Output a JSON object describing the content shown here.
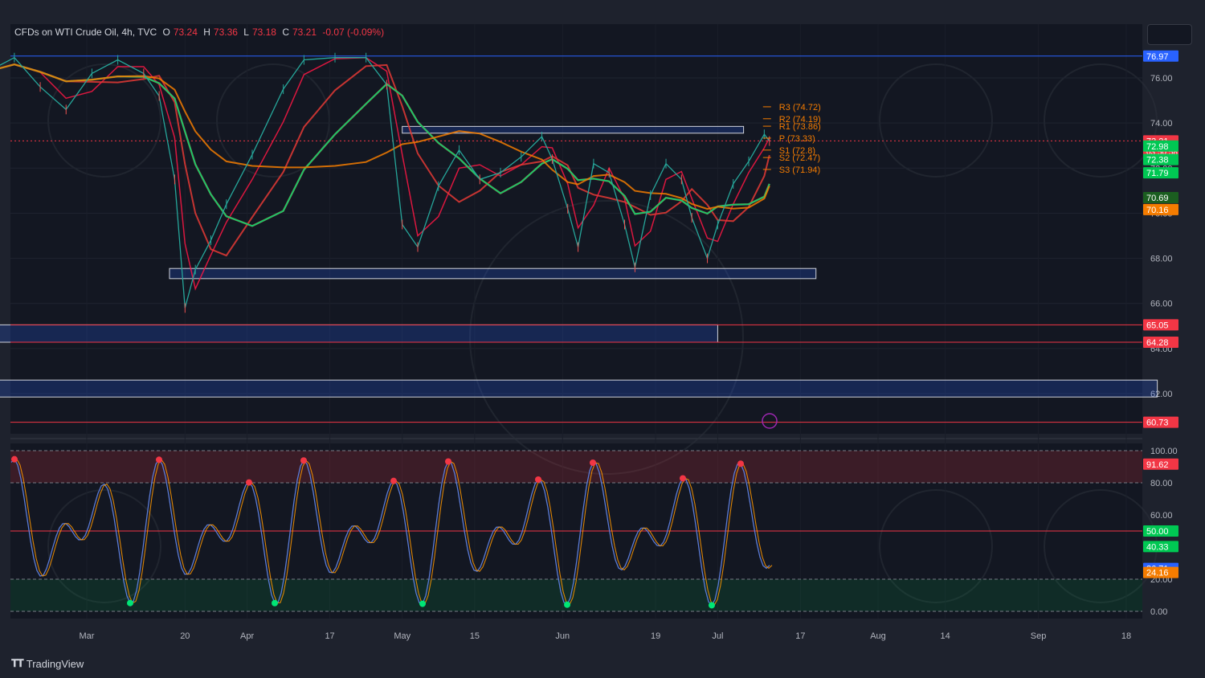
{
  "header": {
    "symbol": "CFDs on WTI Crude Oil, 4h, TVC",
    "open_label": "O",
    "open": "73.24",
    "high_label": "H",
    "high": "73.36",
    "low_label": "L",
    "low": "73.18",
    "close_label": "C",
    "close": "73.21",
    "change": "-0.07 (-0.09%)"
  },
  "brand": {
    "name": "TradingView"
  },
  "chart_data": [
    {
      "type": "line",
      "name": "price",
      "x_ticks": [
        "Mar",
        "20",
        "Apr",
        "17",
        "May",
        "15",
        "Jun",
        "19",
        "Jul",
        "17",
        "Aug",
        "14",
        "Sep",
        "18"
      ],
      "y_ticks": [
        "76.00",
        "74.00",
        "72.00",
        "70.00",
        "68.00",
        "66.00",
        "64.00",
        "62.00"
      ],
      "ylim": [
        59.2,
        77.2
      ],
      "horizontal_levels": [
        {
          "value": 76.97,
          "color": "#2962ff"
        },
        {
          "value": 73.21,
          "color": "#f23645",
          "style": "dotted"
        },
        {
          "value": 65.05,
          "color": "#f23645"
        },
        {
          "value": 64.28,
          "color": "#f23645"
        },
        {
          "value": 60.73,
          "color": "#f23645"
        }
      ],
      "zones": [
        {
          "from": 73.55,
          "to": 73.85,
          "x_start": "2024-05-01",
          "x_end": "2024-07-06"
        },
        {
          "from": 67.1,
          "to": 67.55,
          "x_start": "2024-03-17",
          "x_end": "2024-07-20"
        },
        {
          "from": 64.28,
          "to": 65.05,
          "x_start": "2024-02-11",
          "x_end": "2024-07-01"
        },
        {
          "from": 61.85,
          "to": 62.6,
          "x_start": "2024-02-11",
          "x_end": "2024-09-24"
        }
      ],
      "pivots": [
        {
          "label": "R3 (74.72)",
          "value": 74.72
        },
        {
          "label": "R2 (74.19)",
          "value": 74.19
        },
        {
          "label": "R1 (73.86)",
          "value": 73.86
        },
        {
          "label": "P (73.33)",
          "value": 73.33
        },
        {
          "label": "S1 (72.8)",
          "value": 72.8
        },
        {
          "label": "S2 (72.47)",
          "value": 72.47
        },
        {
          "label": "S3 (71.94)",
          "value": 71.94
        }
      ],
      "price_labels": [
        {
          "text": "76.97",
          "value": 76.97,
          "color": "#2962ff"
        },
        {
          "text": "73.21",
          "value": 73.21,
          "color": "#f23645",
          "sub": "03:50:58"
        },
        {
          "text": "72.98",
          "value": 72.98,
          "color": "#00c853"
        },
        {
          "text": "72.38",
          "value": 72.38,
          "color": "#00c853"
        },
        {
          "text": "71.79",
          "value": 71.79,
          "color": "#00c853"
        },
        {
          "text": "70.69",
          "value": 70.69,
          "color": "#1b5e20"
        },
        {
          "text": "70.16",
          "value": 70.16,
          "color": "#f57c00"
        },
        {
          "text": "65.05",
          "value": 65.05,
          "color": "#f23645"
        },
        {
          "text": "64.28",
          "value": 64.28,
          "color": "#f23645"
        },
        {
          "text": "60.73",
          "value": 60.73,
          "color": "#f23645"
        }
      ],
      "series": [
        {
          "name": "",
          "color": "#26a69a",
          "points": [
            [
              "2024-02-11",
              76.3
            ],
            [
              "2024-02-16",
              76.9
            ],
            [
              "2024-02-21",
              75.6
            ],
            [
              "2024-02-26",
              74.6
            ],
            [
              "2024-03-02",
              76.2
            ],
            [
              "2024-03-07",
              76.8
            ],
            [
              "2024-03-12",
              76.2
            ],
            [
              "2024-03-15",
              75.2
            ],
            [
              "2024-03-18",
              71.5
            ],
            [
              "2024-03-20",
              65.8
            ],
            [
              "2024-03-22",
              67.5
            ],
            [
              "2024-03-25",
              68.8
            ],
            [
              "2024-03-28",
              70.4
            ],
            [
              "2024-04-02",
              72.6
            ],
            [
              "2024-04-08",
              75.5
            ],
            [
              "2024-04-12",
              76.8
            ],
            [
              "2024-04-18",
              76.9
            ],
            [
              "2024-04-24",
              76.9
            ],
            [
              "2024-04-28",
              75.7
            ],
            [
              "2024-05-01",
              69.5
            ],
            [
              "2024-05-04",
              68.5
            ],
            [
              "2024-05-08",
              71.2
            ],
            [
              "2024-05-12",
              72.8
            ],
            [
              "2024-05-16",
              71.5
            ],
            [
              "2024-05-20",
              71.8
            ],
            [
              "2024-05-24",
              72.5
            ],
            [
              "2024-05-28",
              73.4
            ],
            [
              "2024-05-30",
              72.4
            ],
            [
              "2024-06-02",
              70.2
            ],
            [
              "2024-06-04",
              68.5
            ],
            [
              "2024-06-07",
              72.2
            ],
            [
              "2024-06-10",
              71.8
            ],
            [
              "2024-06-13",
              69.5
            ],
            [
              "2024-06-15",
              67.6
            ],
            [
              "2024-06-18",
              70.8
            ],
            [
              "2024-06-21",
              72.2
            ],
            [
              "2024-06-24",
              71.5
            ],
            [
              "2024-06-26",
              69.8
            ],
            [
              "2024-06-29",
              68.0
            ],
            [
              "2024-07-01",
              69.5
            ],
            [
              "2024-07-04",
              71.3
            ],
            [
              "2024-07-07",
              72.3
            ],
            [
              "2024-07-10",
              73.5
            ],
            [
              "2024-07-11",
              73.2
            ]
          ]
        }
      ]
    },
    {
      "type": "line",
      "name": "stochastic",
      "y_ticks": [
        "100.00",
        "80.00",
        "60.00",
        "40.00",
        "20.00",
        "0.00"
      ],
      "ylim": [
        0,
        100
      ],
      "levels": [
        100,
        80,
        50,
        20,
        0
      ],
      "price_labels": [
        {
          "text": "91.62",
          "value": 91.62,
          "color": "#f23645"
        },
        {
          "text": "50.00",
          "value": 50.0,
          "color": "#00c853"
        },
        {
          "text": "40.33",
          "value": 40.33,
          "color": "#00c853"
        },
        {
          "text": "26.71",
          "value": 26.71,
          "color": "#2962ff"
        },
        {
          "text": "24.16",
          "value": 24.16,
          "color": "#f57c00"
        }
      ]
    }
  ]
}
